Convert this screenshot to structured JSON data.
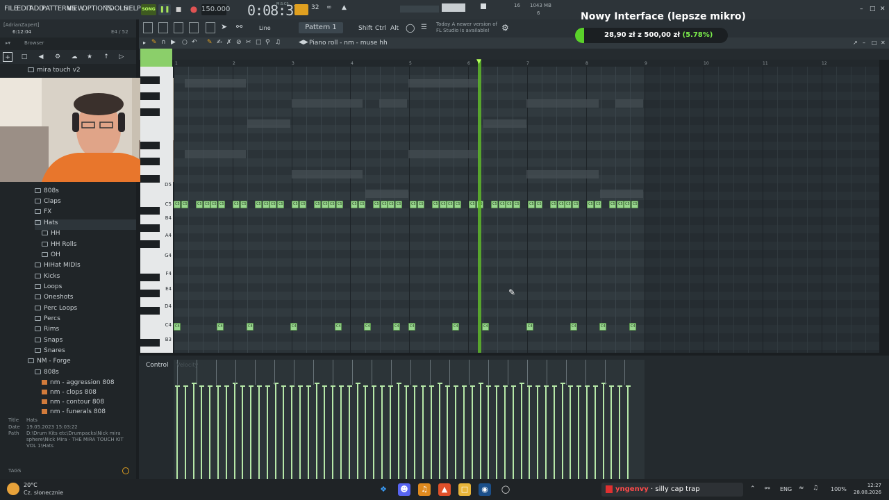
{
  "menu": [
    "FILE",
    "EDIT",
    "ADD",
    "PATTERNS",
    "VIEW",
    "OPTIONS",
    "TOOLS",
    "HELP"
  ],
  "transport": {
    "song_mode": "SONG",
    "tempo": "150.000",
    "time": "0:08:37",
    "time_unit": "M:S:CS",
    "mem": "1043 MB",
    "cpu": "6",
    "voices": "16"
  },
  "toolbar2": {
    "snap": "Line",
    "pattern": "Pattern 1",
    "shift": "Shift",
    "ctrl": "Ctrl",
    "alt": "Alt",
    "news": "Today  A newer version of FL Studio is available!"
  },
  "user": {
    "name": "[AdrianZapert]",
    "time": "6:12:04",
    "pos": "E4 / 52"
  },
  "browser": {
    "title": "Browser",
    "top_folder": "mira touch v2",
    "items": [
      {
        "label": "808s",
        "type": "folder",
        "indent": 1
      },
      {
        "label": "Claps",
        "type": "folder",
        "indent": 1
      },
      {
        "label": "FX",
        "type": "folder",
        "indent": 1
      },
      {
        "label": "Hats",
        "type": "folder",
        "indent": 1
      },
      {
        "label": "HH",
        "type": "folder",
        "indent": 2
      },
      {
        "label": "HH Rolls",
        "type": "folder",
        "indent": 2
      },
      {
        "label": "OH",
        "type": "folder",
        "indent": 2
      },
      {
        "label": "HiHat MIDIs",
        "type": "folder",
        "indent": 1
      },
      {
        "label": "Kicks",
        "type": "folder",
        "indent": 1
      },
      {
        "label": "Loops",
        "type": "folder",
        "indent": 1
      },
      {
        "label": "Oneshots",
        "type": "folder",
        "indent": 1
      },
      {
        "label": "Perc Loops",
        "type": "folder",
        "indent": 1
      },
      {
        "label": "Percs",
        "type": "folder",
        "indent": 1
      },
      {
        "label": "Rims",
        "type": "folder",
        "indent": 1
      },
      {
        "label": "Snaps",
        "type": "folder",
        "indent": 1
      },
      {
        "label": "Snares",
        "type": "folder",
        "indent": 1
      },
      {
        "label": "NM - Forge",
        "type": "folder",
        "indent": 0
      },
      {
        "label": "808s",
        "type": "folder",
        "indent": 1
      },
      {
        "label": "nm - aggression 808",
        "type": "file",
        "indent": 2
      },
      {
        "label": "nm - clops 808",
        "type": "file",
        "indent": 2
      },
      {
        "label": "nm - contour 808",
        "type": "file",
        "indent": 2
      },
      {
        "label": "nm - funerals 808",
        "type": "file",
        "indent": 2
      }
    ],
    "info": {
      "title_key": "Title",
      "title_val": "Hats",
      "date_key": "Date",
      "date_val": "19.05.2023 15:03:22",
      "path_key": "Path",
      "path_val": "D:\\Drum Kits etc\\Drumpacks\\Nick mira sphere\\Nick Mira - THE MIRA TOUCH KIT VOL 1\\Hats"
    },
    "tags": "TAGS"
  },
  "piano_roll": {
    "title": "Piano roll - nm - muse hh",
    "bars": [
      "1",
      "2",
      "3",
      "4",
      "5",
      "6",
      "7",
      "8",
      "9",
      "10",
      "11",
      "12"
    ],
    "keys": [
      "D5",
      "C5",
      "B4",
      "A4",
      "G4",
      "F4",
      "E4",
      "D4",
      "C4",
      "B3"
    ],
    "note_label_c5": "C5",
    "note_label_c4": "C4",
    "control_label": "Control",
    "velocity_label": "Velocity"
  },
  "donation": {
    "title": "Nowy Interface (lepsze mikro)",
    "amount": "28,90 zł z 500,00 zł",
    "percent": "(5.78%)",
    "progress": 0.0578
  },
  "taskbar": {
    "temp": "20°C",
    "weather": "Cz. słonecznie",
    "np_user": "yngenvy",
    "np_track": "· silly cap trap",
    "lang": "ENG",
    "battery": "100%",
    "time": "12:27",
    "date": "28.08.2026"
  },
  "colors": {
    "accent_green": "#5fb82c",
    "note_green": "#98d68e",
    "donate_green": "#5ad12a"
  }
}
